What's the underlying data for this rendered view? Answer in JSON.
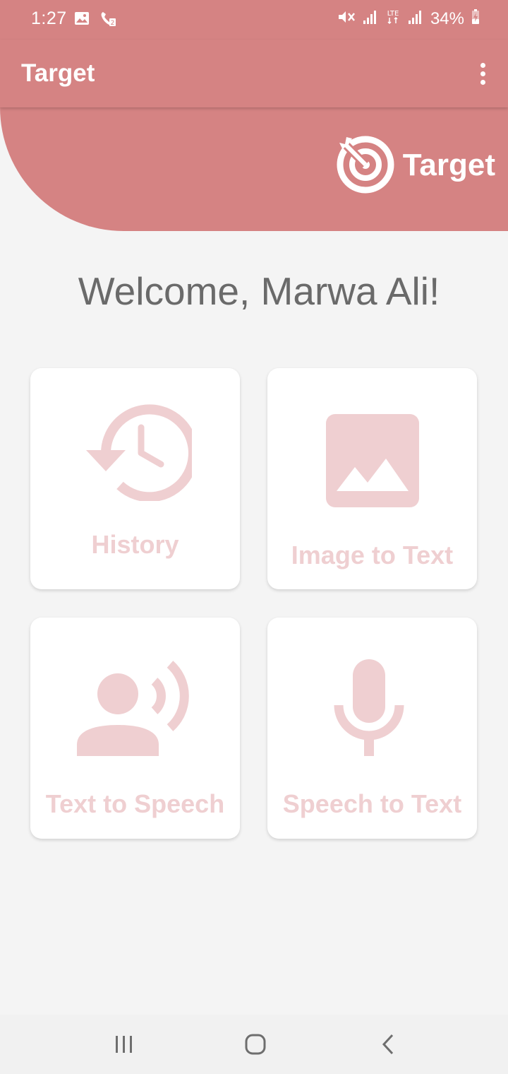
{
  "status_bar": {
    "time": "1:27",
    "battery": "34%",
    "icons_left": [
      "gallery-icon",
      "call-icon"
    ],
    "icons_right": [
      "mute-icon",
      "signal-icon",
      "lte-icon",
      "signal-icon",
      "battery-icon"
    ]
  },
  "app_bar": {
    "title": "Target",
    "menu_icon": "more-vert-icon"
  },
  "banner": {
    "logo_text": "Target",
    "logo_icon": "target-icon"
  },
  "welcome": "Welcome, Marwa Ali!",
  "tiles": [
    {
      "label": "History",
      "icon": "history-icon"
    },
    {
      "label": "Image to Text",
      "icon": "image-icon"
    },
    {
      "label": "Text to Speech",
      "icon": "speaker-icon"
    },
    {
      "label": "Speech to Text",
      "icon": "microphone-icon"
    }
  ],
  "nav_bar": {
    "buttons": [
      "recents-icon",
      "home-icon",
      "back-icon"
    ]
  },
  "colors": {
    "primary": "#d58383",
    "tile_accent": "#efcfd1",
    "background": "#f4f4f4",
    "welcome_text": "#6a6a6a"
  }
}
